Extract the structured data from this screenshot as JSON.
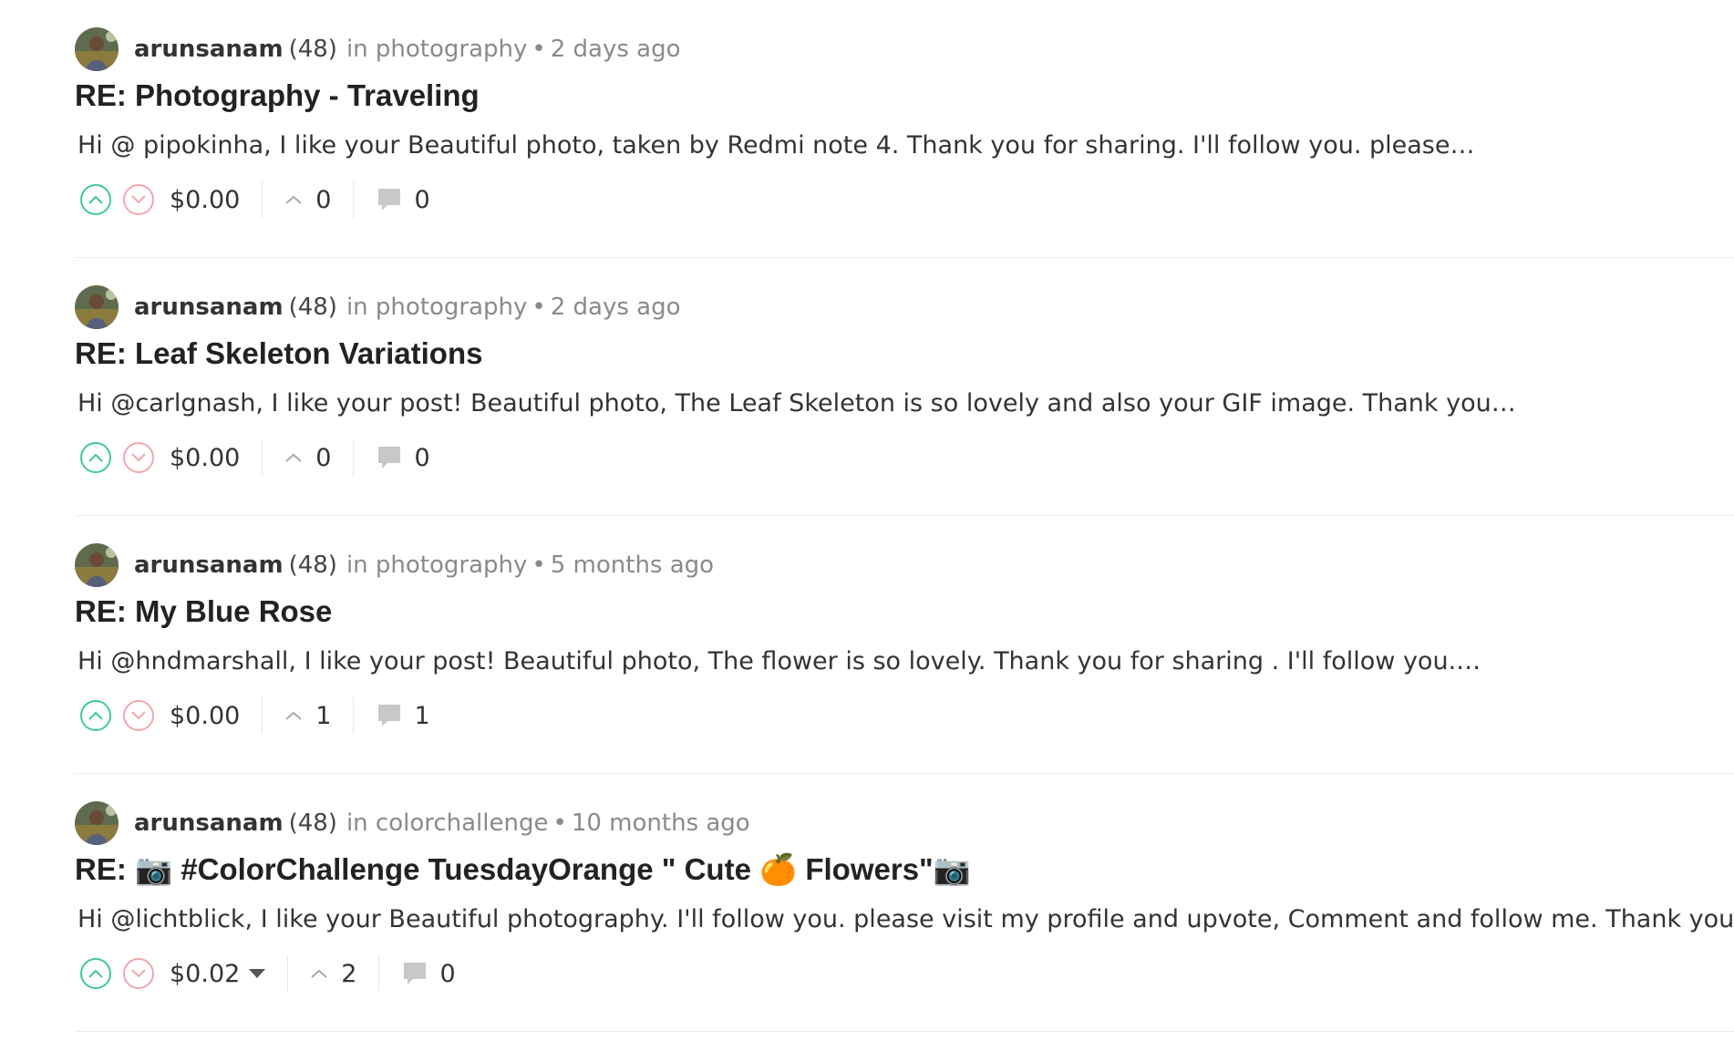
{
  "posts": [
    {
      "author": "arunsanam",
      "reputation": "(48)",
      "community": "in photography",
      "time": "2 days ago",
      "title": "RE: Photography - Traveling",
      "body": "Hi @ pipokinha, I like your Beautiful photo, taken by Redmi note 4. Thank you for sharing. I'll follow you. please…",
      "payout": "$0.00",
      "has_payout_menu": false,
      "votes": "0",
      "comments": "0"
    },
    {
      "author": "arunsanam",
      "reputation": "(48)",
      "community": "in photography",
      "time": "2 days ago",
      "title": "RE: Leaf Skeleton Variations",
      "body": "Hi @carlgnash, I like your post! Beautiful photo, The Leaf Skeleton is so lovely and also your GIF image. Thank you…",
      "payout": "$0.00",
      "has_payout_menu": false,
      "votes": "0",
      "comments": "0"
    },
    {
      "author": "arunsanam",
      "reputation": "(48)",
      "community": "in photography",
      "time": "5 months ago",
      "title": "RE: My Blue Rose",
      "body": "Hi @hndmarshall, I like your post! Beautiful photo, The flower is so lovely. Thank you for sharing . I'll follow you.…",
      "payout": "$0.00",
      "has_payout_menu": false,
      "votes": "1",
      "comments": "1"
    },
    {
      "author": "arunsanam",
      "reputation": "(48)",
      "community": "in colorchallenge",
      "time": "10 months ago",
      "title": "RE: 📷  #ColorChallenge TuesdayOrange \" Cute 🍊  Flowers\"📷",
      "body": "Hi @lichtblick, I like your Beautiful photography. I'll follow you. please visit my profile and upvote, Comment and follow me. Thank you.",
      "payout": "$0.02",
      "has_payout_menu": true,
      "votes": "2",
      "comments": "0"
    }
  ],
  "colors": {
    "upvote": "#3fc99a",
    "downvote": "#f2a6ad",
    "muted_text": "#8a8a8a",
    "divider": "#ececec"
  },
  "icons": {
    "upvote": "chevron-up-circle-icon",
    "downvote": "chevron-down-circle-icon",
    "votes": "chevron-up-icon",
    "comments": "comment-bubble-icon",
    "payout_menu": "caret-down-icon"
  }
}
